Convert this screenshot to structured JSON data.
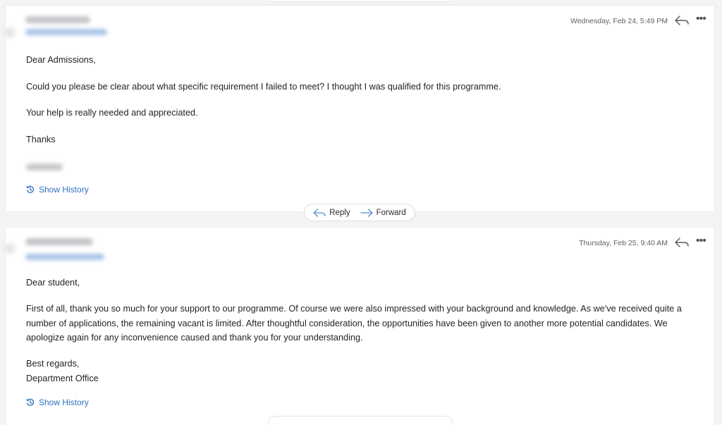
{
  "messages": [
    {
      "date": "Wednesday, Feb 24, 5:49 PM",
      "greeting": "Dear Admissions,",
      "paragraphs": [
        "Could you please be clear about what specific requirement I failed to meet? I thought I was qualified for this programme.",
        "Your help is really needed and appreciated.",
        "Thanks"
      ],
      "show_history": "Show History"
    },
    {
      "date": "Thursday, Feb 25, 9:40 AM",
      "greeting": "Dear student,",
      "paragraphs": [
        "First of all, thank you so much for your support to our programme. Of course we were also impressed with your background and  knowledge.  As we've received quite a number of applications, the remaining vacant is limited. After thoughtful consideration, the opportunities have been given to another more potential candidates. We apologize again for any inconvenience caused and thank you for your understanding."
      ],
      "closing": "Best regards,",
      "signature": "Department Office",
      "show_history": "Show History"
    }
  ],
  "actions": {
    "reply": "Reply",
    "forward": "Forward"
  },
  "icons": {
    "reply": "reply-arrow-icon",
    "forward": "forward-arrow-icon",
    "more": "more-options-icon",
    "history": "history-clock-icon"
  },
  "colors": {
    "link": "#2f6fbf",
    "reply_icon": "#5b8fd0"
  }
}
